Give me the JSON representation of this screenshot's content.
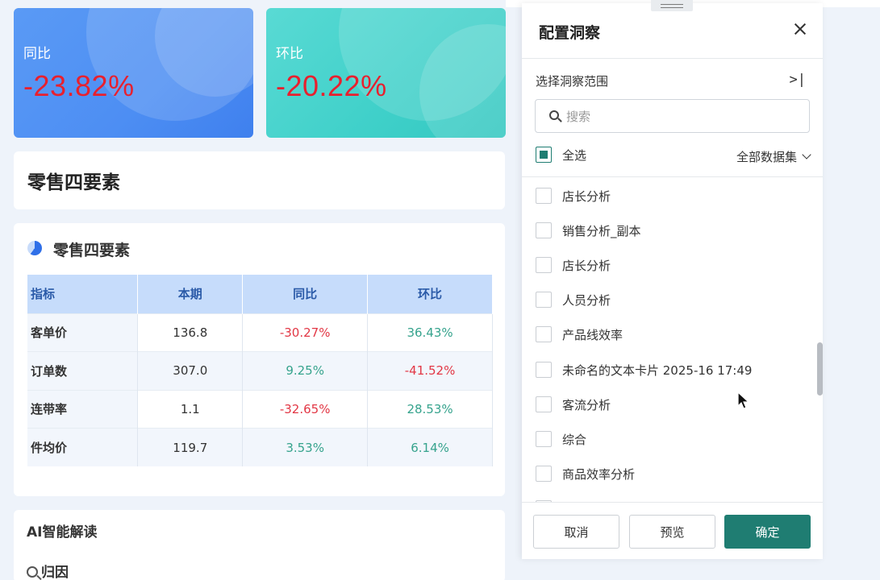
{
  "kpis": [
    {
      "label": "同比",
      "value": "-23.82%"
    },
    {
      "label": "环比",
      "value": "-20.22%"
    }
  ],
  "section_title": "零售四要素",
  "table": {
    "title": "零售四要素",
    "headers": [
      "指标",
      "本期",
      "同比",
      "环比"
    ],
    "rows": [
      [
        "客单价",
        "136.8",
        "-30.27%",
        "36.43%"
      ],
      [
        "订单数",
        "307.0",
        "9.25%",
        "-41.52%"
      ],
      [
        "连带率",
        "1.1",
        "-32.65%",
        "28.53%"
      ],
      [
        "件均价",
        "119.7",
        "3.53%",
        "6.14%"
      ]
    ]
  },
  "ai": {
    "title": "AI智能解读",
    "sub": "归因"
  },
  "drawer": {
    "title": "配置洞察",
    "scope_label": "选择洞察范围",
    "collapse_glyph": ">|",
    "search_placeholder": "搜索",
    "select_all": "全选",
    "dataset_filter": "全部数据集",
    "items": [
      "店长分析",
      "销售分析_副本",
      "店长分析",
      "人员分析",
      "产品线效率",
      "未命名的文本卡片 2025-16 17:49",
      "客流分析",
      "综合",
      "商品效率分析"
    ],
    "buttons": {
      "cancel": "取消",
      "preview": "预览",
      "confirm": "确定"
    }
  },
  "colors": {
    "accent": "#1f7d72",
    "negative": "#e23745",
    "positive": "#36a38d",
    "kpi_blue": "#4d8ef3",
    "kpi_teal": "#3fd0c9"
  }
}
